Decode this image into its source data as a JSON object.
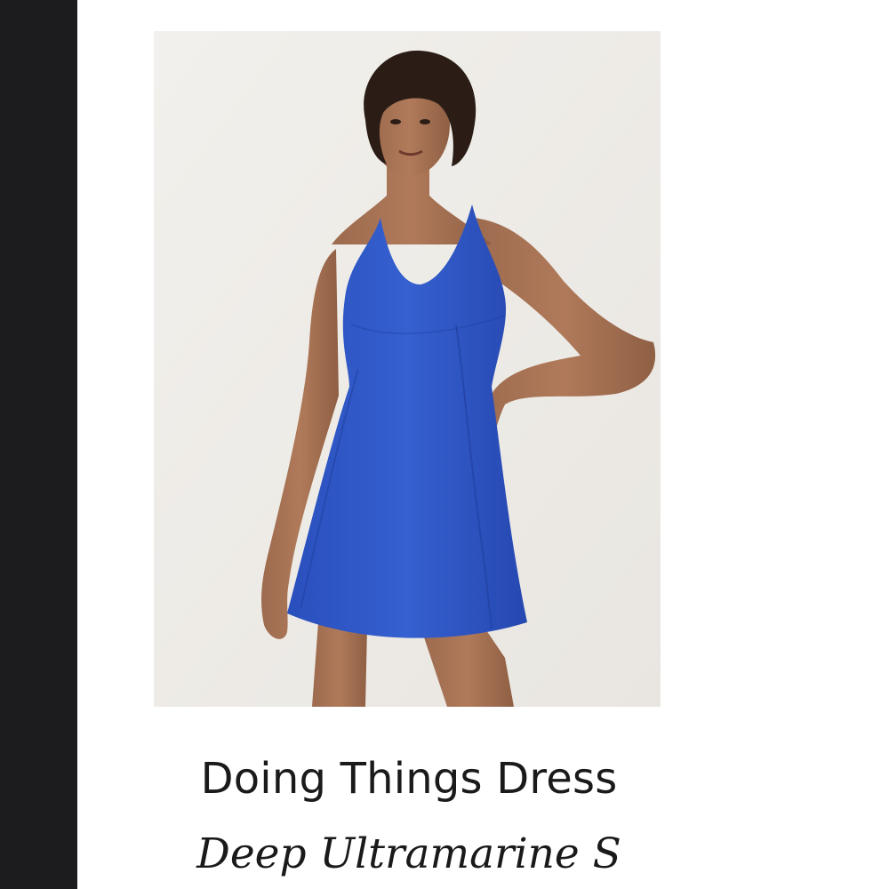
{
  "product": {
    "name": "Doing Things Dress",
    "variant": "Deep Ultramarine S"
  },
  "image": {
    "subject": "product-photo-blue-dress",
    "background_color": "#efede9",
    "dress_color": "#2f56c4"
  },
  "colors": {
    "sidebar": "#1c1c1e",
    "page_background": "#ffffff",
    "text": "#1a1a1a"
  }
}
